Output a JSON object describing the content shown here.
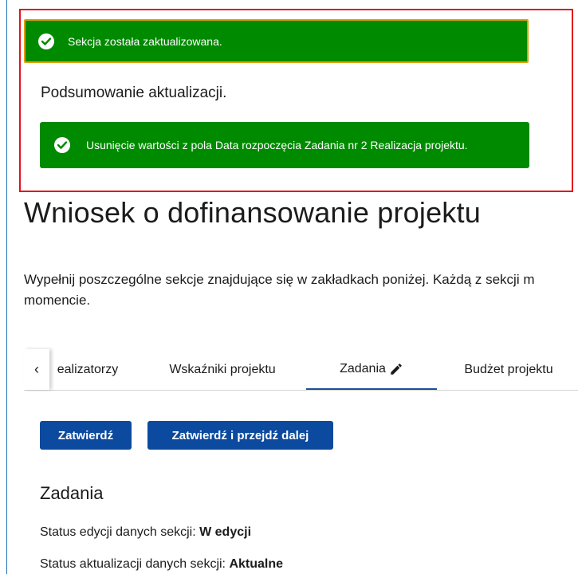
{
  "notifications": {
    "section_updated": "Sekcja została zaktualizowana.",
    "summary_title": "Podsumowanie aktualizacji.",
    "change_item": "Usunięcie wartości z pola Data rozpoczęcia Zadania nr 2 Realizacja projektu."
  },
  "page": {
    "title": "Wniosek o dofinansowanie projektu",
    "intro_line1": "Wypełnij poszczególne sekcje znajdujące się w zakładkach poniżej. Każdą z sekcji m",
    "intro_line2": "momencie."
  },
  "tabs": {
    "prev_symbol": "‹",
    "items": [
      {
        "label": "ealizatorzy"
      },
      {
        "label": "Wskaźniki projektu"
      },
      {
        "label": "Zadania"
      },
      {
        "label": "Budżet projektu"
      }
    ],
    "active_index": 2
  },
  "actions": {
    "confirm_label": "Zatwierdź",
    "confirm_next_label": "Zatwierdź i przejdź dalej"
  },
  "section": {
    "title": "Zadania",
    "edit_status_label": "Status edycji danych sekcji:",
    "edit_status_value": "W edycji",
    "update_status_label": "Status aktualizacji danych sekcji:",
    "update_status_value": "Aktualne"
  },
  "colors": {
    "success": "#008a00",
    "highlight_border": "#e3121c",
    "primary_button": "#0b4a9e"
  }
}
